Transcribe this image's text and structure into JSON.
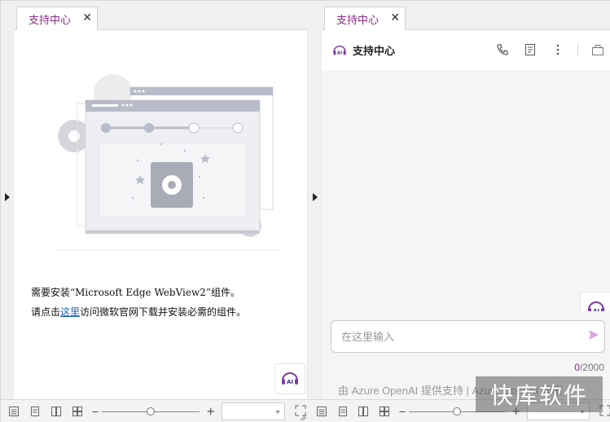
{
  "left_pane": {
    "tab": {
      "label": "支持中心",
      "close": "✕"
    },
    "message_line1": "需要安装“Microsoft Edge WebView2”组件。",
    "message_line2_prefix": "请点击",
    "message_line2_link": "这里",
    "message_line2_suffix": "访问微软官网下载并安装必需的组件。",
    "ai_badge": "AI"
  },
  "right_pane": {
    "tab": {
      "label": "支持中心",
      "close": "✕"
    },
    "header_title": "支持中心",
    "header_icons": [
      "phone-icon",
      "notes-icon",
      "more-icon",
      "sidebar-toggle-icon"
    ],
    "input_placeholder": "在这里输入",
    "counter_current": "0",
    "counter_max": "/2000",
    "powered_by": "由 Azure OpenAI 提供支持 | Azure OpenAI 答案",
    "ai_badge": "AI"
  },
  "statusbar": {
    "view_icons": [
      "normal-view-icon",
      "page-view-icon",
      "two-page-view-icon",
      "multi-page-view-icon"
    ],
    "zoom_minus": "‒",
    "zoom_plus": "+",
    "zoom_level": 0.5
  },
  "watermark": "快库软件",
  "colors": {
    "accent": "#8a2d87",
    "link": "#1a5fb4"
  }
}
